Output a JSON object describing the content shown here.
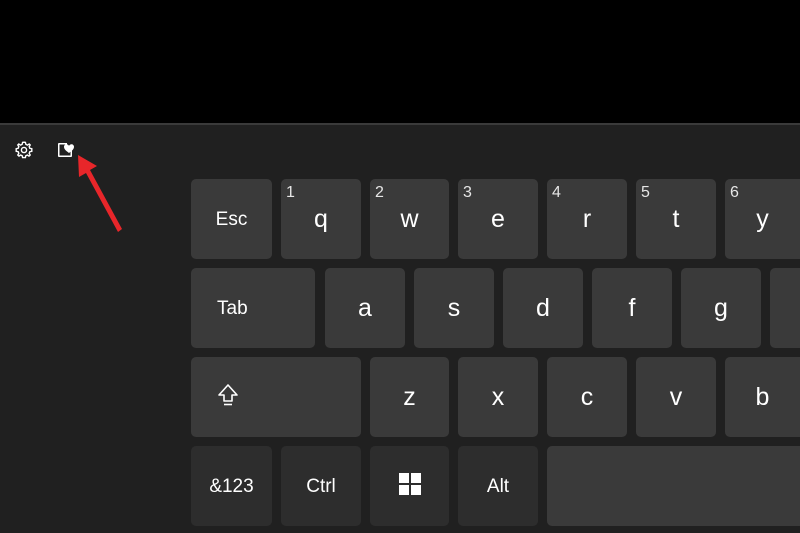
{
  "toolbar": {
    "icons": [
      "gear-icon",
      "sticker-heart-icon"
    ]
  },
  "keyboard": {
    "row1": [
      {
        "label": "Esc"
      },
      {
        "label": "q",
        "hint": "1"
      },
      {
        "label": "w",
        "hint": "2"
      },
      {
        "label": "e",
        "hint": "3"
      },
      {
        "label": "r",
        "hint": "4"
      },
      {
        "label": "t",
        "hint": "5"
      },
      {
        "label": "y",
        "hint": "6"
      }
    ],
    "row2": [
      {
        "label": "Tab"
      },
      {
        "label": "a"
      },
      {
        "label": "s"
      },
      {
        "label": "d"
      },
      {
        "label": "f"
      },
      {
        "label": "g"
      }
    ],
    "row3": [
      {
        "icon": "shift-icon"
      },
      {
        "label": "z"
      },
      {
        "label": "x"
      },
      {
        "label": "c"
      },
      {
        "label": "v"
      },
      {
        "label": "b"
      }
    ],
    "row4": [
      {
        "label": "&123"
      },
      {
        "label": "Ctrl"
      },
      {
        "icon": "windows-logo-icon"
      },
      {
        "label": "Alt"
      },
      {
        "label": ""
      }
    ]
  },
  "colors": {
    "background": "#000000",
    "panel": "#202020",
    "key": "#3a3a3a",
    "key_dark": "#2d2d2d",
    "text": "#ffffff",
    "annotation_arrow": "#e8262a"
  }
}
